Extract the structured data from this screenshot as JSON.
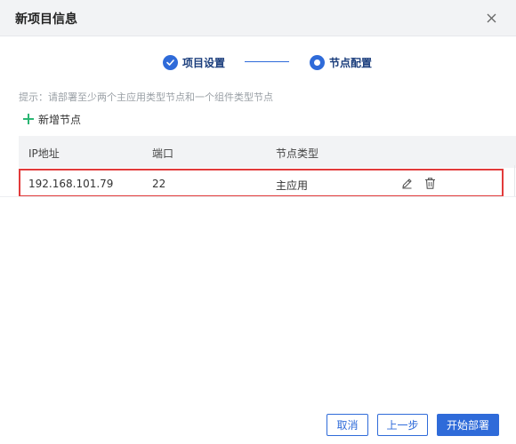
{
  "dialog": {
    "title": "新项目信息",
    "close_icon": "close-icon"
  },
  "steps": [
    {
      "label": "项目设置",
      "state": "done",
      "icon": "check-circle-icon"
    },
    {
      "label": "节点配置",
      "state": "active",
      "icon": "radio-dot-icon"
    }
  ],
  "hint": "提示：请部署至少两个主应用类型节点和一个组件类型节点",
  "add_node": {
    "label": "新增节点",
    "icon": "plus-icon"
  },
  "table": {
    "columns": [
      "IP地址",
      "端口",
      "节点类型"
    ],
    "rows": [
      {
        "ip": "192.168.101.79",
        "port": "22",
        "type": "主应用",
        "actions": [
          "edit-icon",
          "trash-icon"
        ]
      }
    ]
  },
  "footer": {
    "cancel_label": "取消",
    "prev_label": "上一步",
    "deploy_label": "开始部署"
  },
  "colors": {
    "accent": "#2f6bd9",
    "highlight_border": "#e23b3b",
    "add_icon": "#2bb673"
  }
}
